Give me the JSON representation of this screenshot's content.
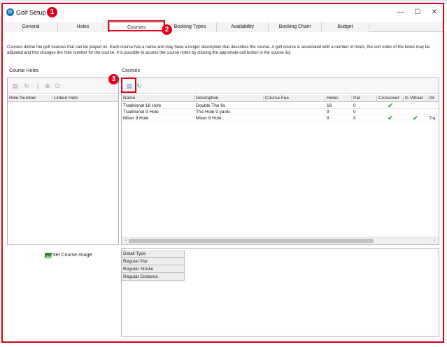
{
  "window": {
    "title": "Golf Setup",
    "minimize": "—",
    "maximize": "☐",
    "close": "✕"
  },
  "annotations": [
    "1",
    "2",
    "3"
  ],
  "tabs": [
    {
      "label": "General"
    },
    {
      "label": "Holes"
    },
    {
      "label": "Courses"
    },
    {
      "label": "Booking Types"
    },
    {
      "label": "Availability"
    },
    {
      "label": "Booking Chain"
    },
    {
      "label": "Budget"
    }
  ],
  "description": "Courses define the golf courses that can be played on. Each course has a name and may have a longer description that describes the course. A golf course is associated with a number of holes, the sort order of the holes may be adjusted and this changes the hole number for the course. It is possible to access the course notes by clicking the approriate cell button in the course list.",
  "course_holes": {
    "label": "Course Holes",
    "columns": [
      "Hole Number",
      "Linked Hole"
    ],
    "set_image_label": "Set Course Image"
  },
  "courses": {
    "label": "Courses",
    "columns": [
      "Name",
      "Description",
      "Course Fee",
      "Holes",
      "Par",
      "Crossover",
      "Is Virtual",
      "Vir"
    ],
    "rows": [
      {
        "name": "Traditional 18 Hole",
        "description": "Double The 9s",
        "fee": "",
        "holes": "18",
        "par": "0",
        "crossover": true,
        "virtual": false,
        "vir": ""
      },
      {
        "name": "Traditional 9 Hole",
        "description": "The Hole 9 yards",
        "fee": "",
        "holes": "9",
        "par": "0",
        "crossover": false,
        "virtual": false,
        "vir": ""
      },
      {
        "name": "Mixer 9 Hole",
        "description": "Mixer 9 Hole",
        "fee": "",
        "holes": "9",
        "par": "0",
        "crossover": true,
        "virtual": true,
        "vir": "Tra"
      }
    ],
    "check_glyph": "✔"
  },
  "details": {
    "header": "Detail Type",
    "items": [
      "Regular Par",
      "Regular Stroke",
      "Regular Distance"
    ]
  },
  "colors": {
    "annotation_red": "#e0001b",
    "check_green": "#34a84a",
    "app_icon_blue": "#1f6fb5"
  }
}
